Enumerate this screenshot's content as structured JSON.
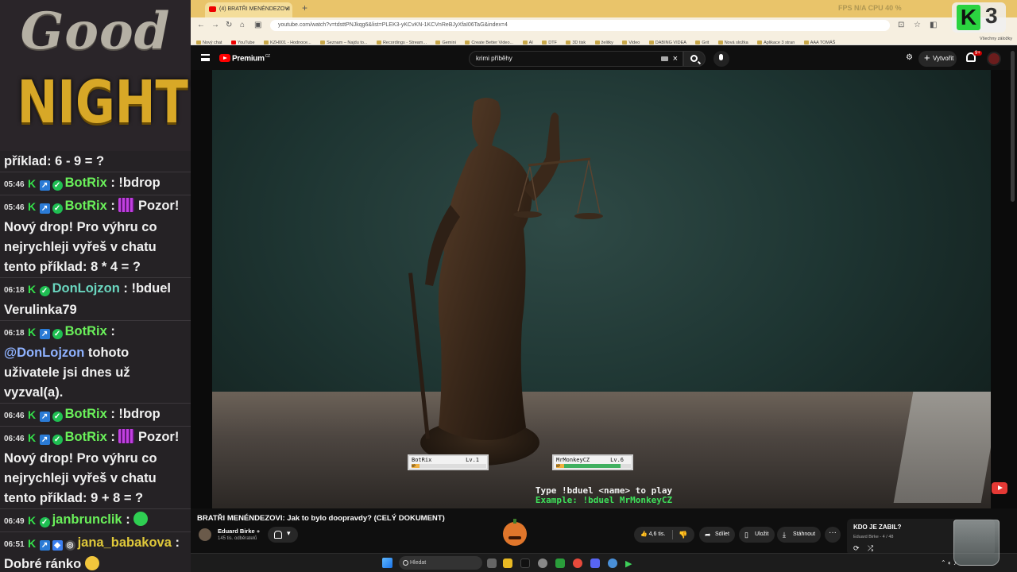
{
  "overlay": {
    "good": "Good",
    "night": "NIGHT",
    "counter": "3"
  },
  "chat": {
    "messages": [
      {
        "time": "",
        "user": "",
        "text": "příklad: 6 - 9 = ?"
      },
      {
        "time": "05:46",
        "user": "BotRix",
        "text": "!bdrop"
      },
      {
        "time": "05:46",
        "user": "BotRix",
        "text": "Pozor! Nový drop!  Pro výhru co nejrychleji vyřeš v chatu tento příklad: 8 * 4 = ?"
      },
      {
        "time": "06:18",
        "user": "DonLojzon",
        "text": "!bduel Verulinka79"
      },
      {
        "time": "06:18",
        "user": "BotRix",
        "mention": "@DonLojzon",
        "text": "tohoto uživatele jsi dnes už vyzval(a)."
      },
      {
        "time": "06:46",
        "user": "BotRix",
        "text": "!bdrop"
      },
      {
        "time": "06:46",
        "user": "BotRix",
        "text": "Pozor! Nový drop!  Pro výhru co nejrychleji vyřeš v chatu tento příklad: 9 + 8 = ?"
      },
      {
        "time": "06:49",
        "user": "janbrunclik",
        "text": ""
      },
      {
        "time": "06:51",
        "user": "jana_babakova",
        "text": "Dobré ránko"
      }
    ]
  },
  "browser": {
    "tab_title": "(4) BRATŘI MENÉNDEZOVI",
    "url": "youtube.com/watch?v=tdsttPNJkqg6&list=PLEK3-yKCvKN-1KCVnReBJyXfaI06TaG&index=4",
    "perf_text": "FPS N/A     CPU 40 %",
    "bookmarks": [
      "Nový chat",
      "YouTube",
      "KZH001 - Hodnoce...",
      "Seznam – Najdu to...",
      "Recordings - Stream...",
      "Gemini",
      "Create Better Video...",
      "AI",
      "DTF",
      "3D tisk",
      "želitky",
      "Video",
      "DABING VIDEA",
      "Grit",
      "Nová složka",
      "Aplikace 3 stran",
      "AAA TOMÁŠ"
    ],
    "all_bookmarks": "Všechny záložky"
  },
  "youtube": {
    "brand": "Premium",
    "brand_sup": "CZ",
    "search_value": "krimi příběhy",
    "create_label": "Vytvořit",
    "notif_count": "9+",
    "video_title": "BRATŘI MENÉNDEZOVI: Jak to bylo doopravdy? (CELÝ DOKUMENT)",
    "channel": "Eduard Birke",
    "subscribers": "145 tis. odběratelů",
    "likes": "4,6 tis.",
    "share": "Sdílet",
    "save": "Uložit",
    "download": "Stáhnout",
    "playlist_title": "KDO JE ZABIL?",
    "playlist_sub": "Eduard Birke - 4 / 48"
  },
  "duel": {
    "p1_name": "BotRix",
    "p1_level": "Lv.1",
    "p1_hp": 0.0,
    "p2_name": "MrMonkeyCZ",
    "p2_level": "Lv.6",
    "p2_hp": 0.85,
    "hp_label": "HP",
    "line1": "Type !bduel <name> to play",
    "line2": "Example: !bduel MrMonkeyCZ"
  },
  "taskbar": {
    "search_placeholder": "Hledat"
  },
  "colors": {
    "tabbar": "#e9c46a",
    "night": "#d8a827",
    "botrix": "#6af05a",
    "duel_line1": "#f2f2f2",
    "duel_line2": "#3ee05a"
  }
}
